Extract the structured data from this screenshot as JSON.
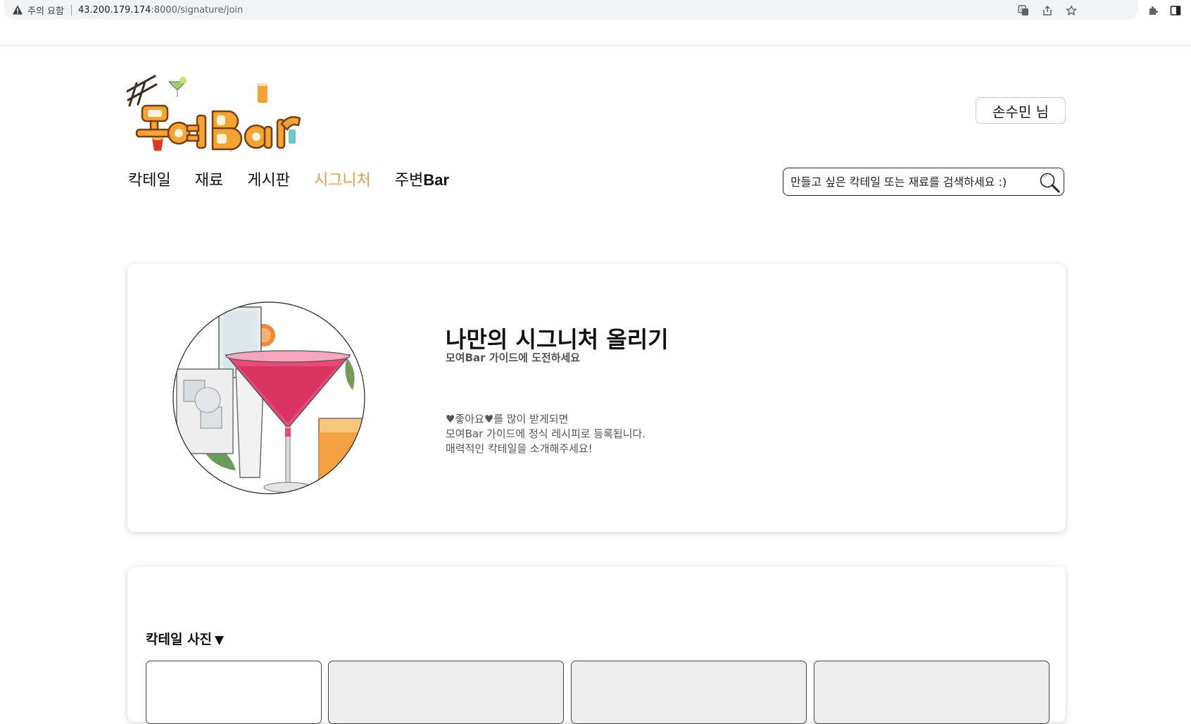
{
  "browser": {
    "security_label": "주의 요함",
    "url_host": "43.200.179.174",
    "url_path": ":8000/signature/join",
    "icons": [
      "warning-icon",
      "translate-icon",
      "share-icon",
      "star-icon",
      "puzzle-icon",
      "sidepanel-icon"
    ]
  },
  "header": {
    "logo_alt": "#모여Bar",
    "user_label": "손수민 님",
    "nav": [
      {
        "label": "칵테일"
      },
      {
        "label": "재료"
      },
      {
        "label": "게시판"
      },
      {
        "label": "시그니처",
        "active": true
      },
      {
        "label": "주변",
        "suffix": "Bar"
      }
    ],
    "search_placeholder": "만들고 싶은 칵테일 또는 재료를 검색하세요 :)",
    "search_icon": "magnifier-icon"
  },
  "intro": {
    "title": "나만의 시그니처 올리기",
    "subtitle": "모여Bar 가이드에 도전하세요",
    "desc": [
      "♥좋아요♥를 많이 받게되면",
      "모여Bar 가이드에 정식 레시피로 등록됩니다.",
      "매력적인 칵테일을 소개해주세요!"
    ],
    "image": "cocktail-glasses-illustration"
  },
  "photos": {
    "label": "칵테일 사진",
    "toggle": "▼"
  },
  "colors": {
    "accent": "#dba24d",
    "card_shadow": "rgba(0,0,0,0.16)",
    "slot_fill": "#eeeeee"
  }
}
